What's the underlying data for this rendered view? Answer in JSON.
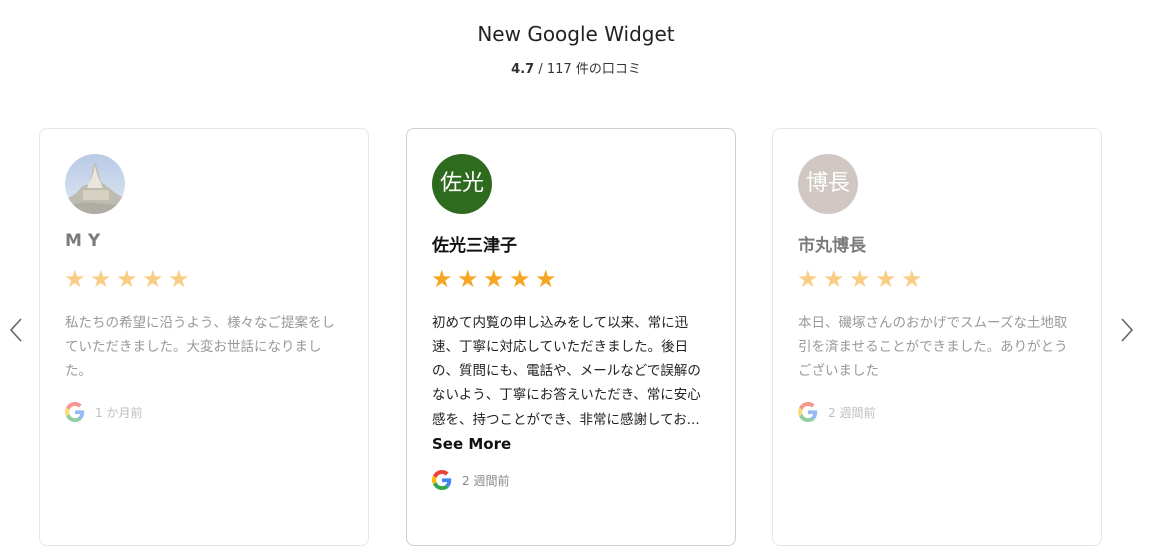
{
  "widget": {
    "title": "New Google Widget",
    "rating": "4.7",
    "separator": "/",
    "count_label": "117 件の口コミ"
  },
  "navigation": {
    "prev_icon": "chevron-left-icon",
    "next_icon": "chevron-right-icon"
  },
  "colors": {
    "star": "#f5a623",
    "avatar_2": "#2e6b1f",
    "avatar_3": "#aa9b93"
  },
  "reviews": [
    {
      "name": "M Y",
      "avatar_type": "photo",
      "rating": 5,
      "text": "私たちの希望に沿うよう、様々なご提案をしていただきました。大変お世話になりました。",
      "time": "1 か月前",
      "source_icon": "google-icon"
    },
    {
      "name": "佐光三津子",
      "avatar_text": "佐光",
      "rating": 5,
      "text": "初めて内覧の申し込みをして以来、常に迅速、丁寧に対応していただきました。後日の、質問にも、電話や、メールなどで誤解のないよう、丁寧にお答えいただき、常に安心感を、持つことができ、非常に感謝してお...",
      "see_more": " See More",
      "time": "2 週間前",
      "source_icon": "google-icon"
    },
    {
      "name": "市丸博長",
      "avatar_text": "博長",
      "rating": 5,
      "text": "本日、磯塚さんのおかげでスムーズな土地取引を済ませることができました。ありがとうございました",
      "time": "2 週間前",
      "source_icon": "google-icon"
    }
  ]
}
